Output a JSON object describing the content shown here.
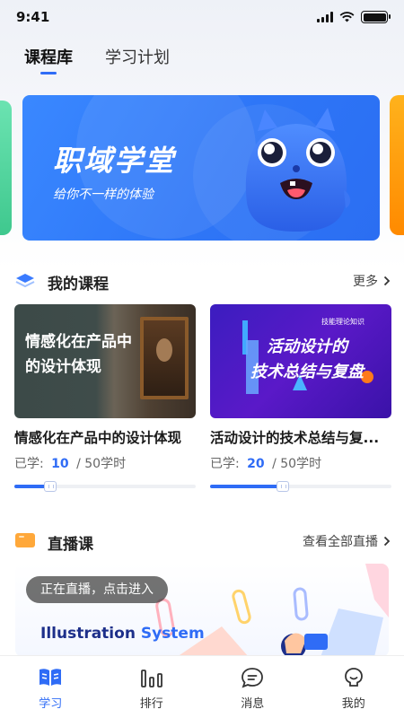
{
  "status_bar": {
    "time": "9:41"
  },
  "top_tabs": [
    {
      "label": "课程库",
      "active": true
    },
    {
      "label": "学习计划",
      "active": false
    }
  ],
  "banner": {
    "title": "职域学堂",
    "subtitle": "给你不一样的体验"
  },
  "my_courses": {
    "title": "我的课程",
    "more": "更多",
    "items": [
      {
        "thumb_text": [
          "情感化在产品中",
          "的设计体现"
        ],
        "title": "情感化在产品中的设计体现",
        "learned_label": "已学:",
        "learned": "10",
        "total": "/ 50学时",
        "progress": 0.2
      },
      {
        "thumb_small": "技能理论知识",
        "thumb_text": [
          "活动设计的",
          "技术总结与复盘"
        ],
        "title": "活动设计的技术总结与复...",
        "learned_label": "已学:",
        "learned": "20",
        "total": "/ 50学时",
        "progress": 0.4
      }
    ]
  },
  "live": {
    "title": "直播课",
    "more": "查看全部直播",
    "badge": "正在直播，点击进入",
    "banner_text_a": "Illustration",
    "banner_text_b": "System"
  },
  "bottom_nav": [
    {
      "label": "学习",
      "icon": "book-icon",
      "active": true
    },
    {
      "label": "排行",
      "icon": "ranking-icon",
      "active": false
    },
    {
      "label": "消息",
      "icon": "message-icon",
      "active": false
    },
    {
      "label": "我的",
      "icon": "profile-icon",
      "active": false
    }
  ],
  "colors": {
    "accent": "#2f6cf6",
    "banner": "#2e76f7",
    "live_icon": "#ffa83a"
  }
}
